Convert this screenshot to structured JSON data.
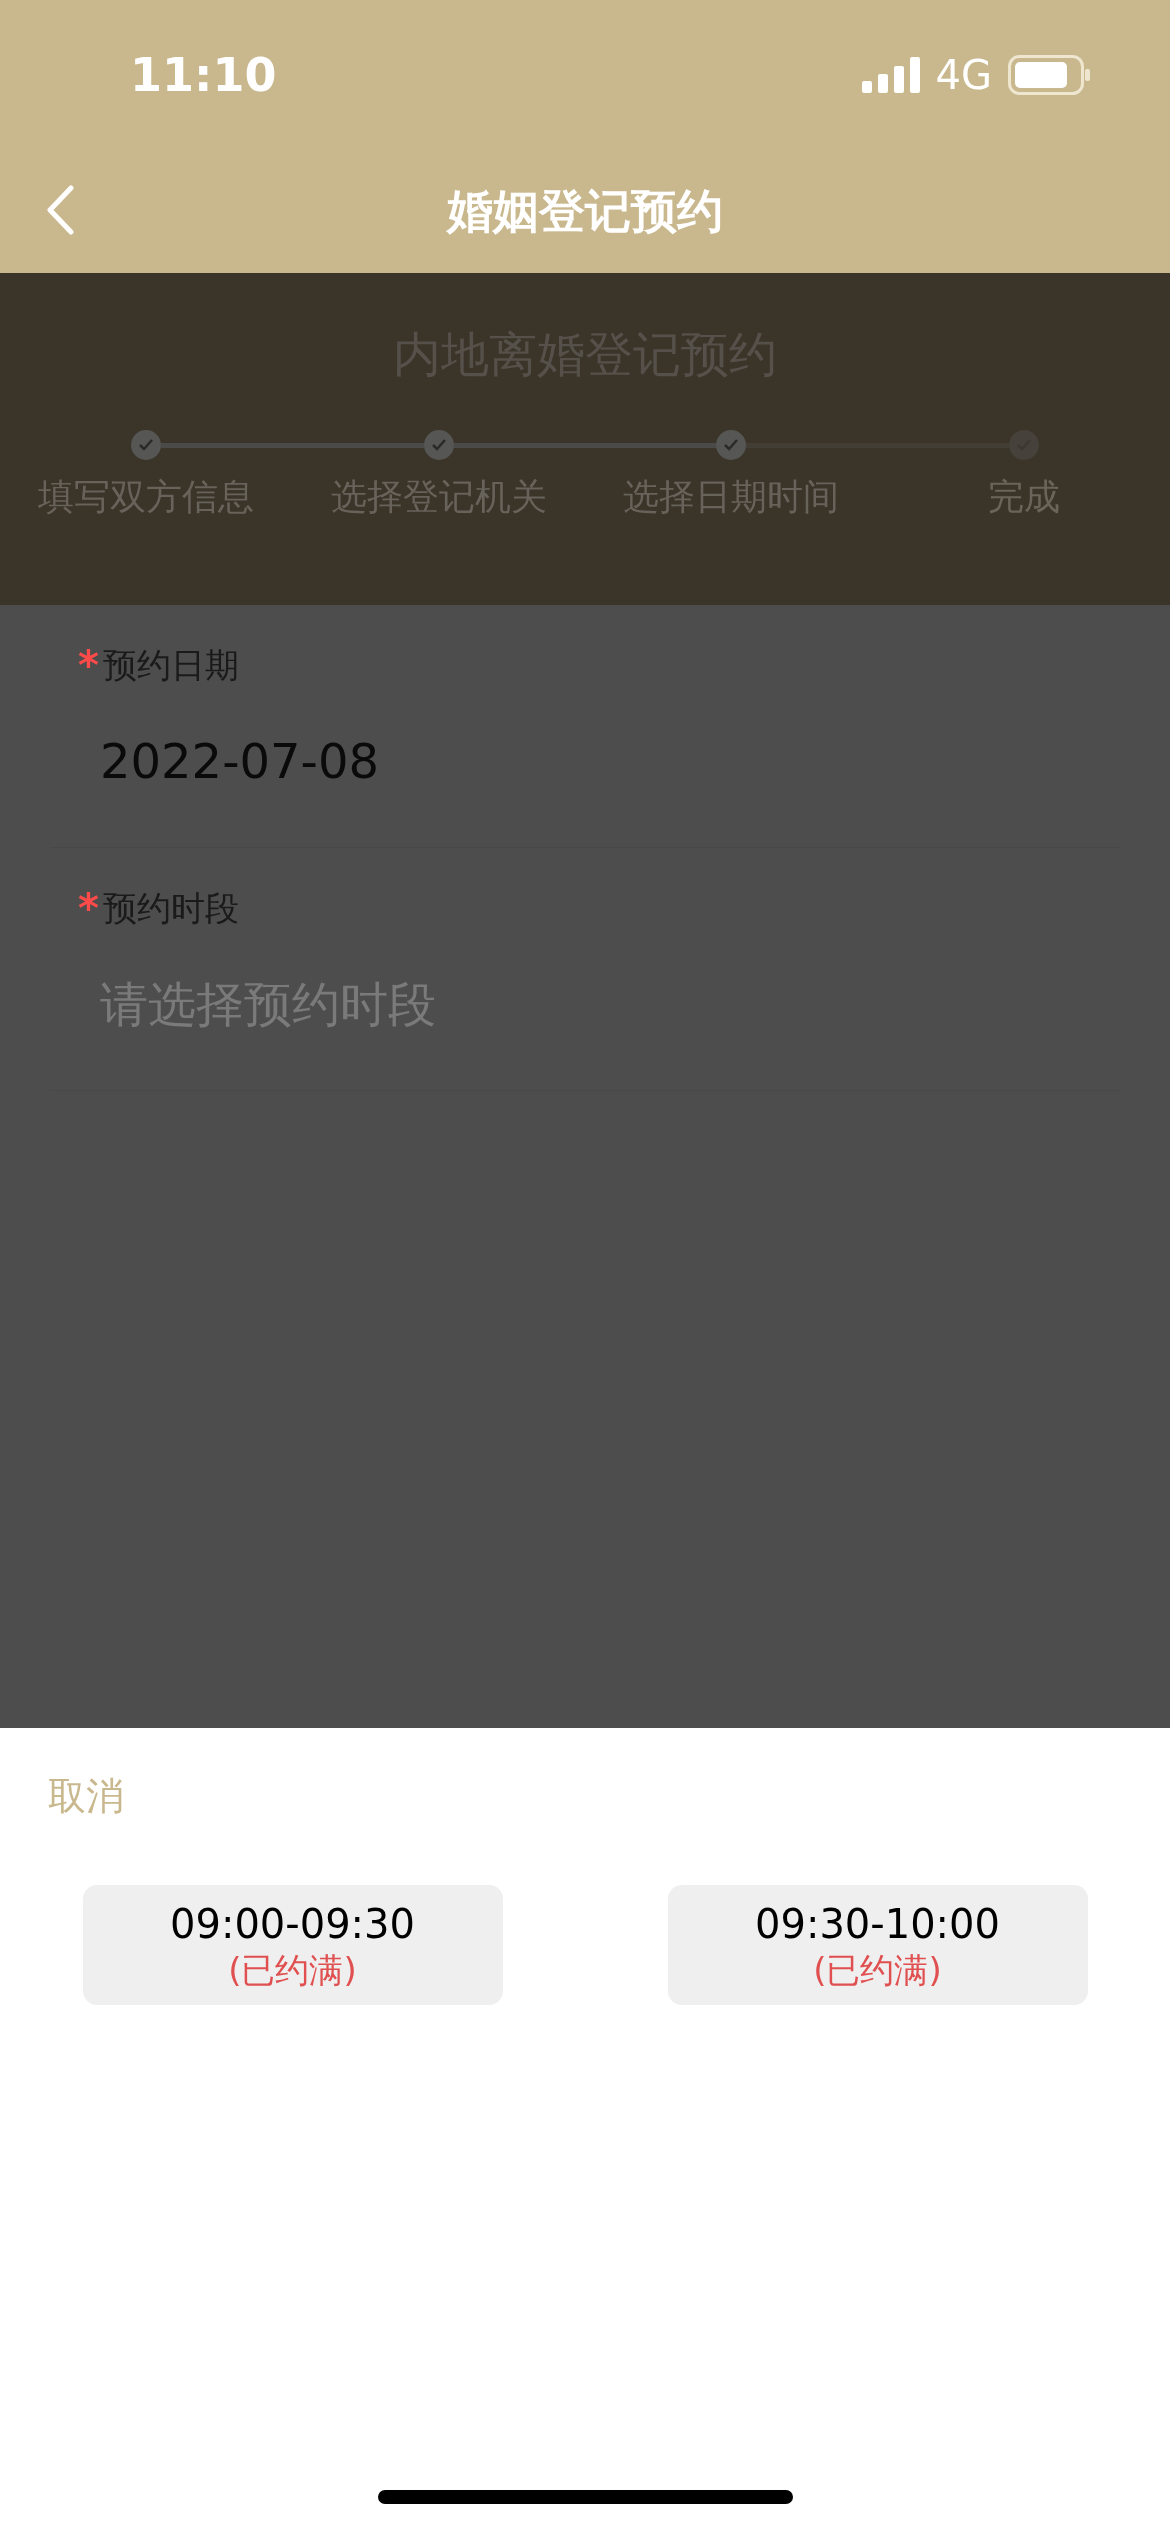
{
  "status_bar": {
    "time": "11:10",
    "network": "4G"
  },
  "nav": {
    "title": "婚姻登记预约"
  },
  "header": {
    "title": "内地离婚登记预约",
    "steps": [
      {
        "label": "填写双方信息",
        "done": true
      },
      {
        "label": "选择登记机关",
        "done": true
      },
      {
        "label": "选择日期时间",
        "done": true
      },
      {
        "label": "完成",
        "done": false
      }
    ]
  },
  "form": {
    "fields": [
      {
        "marker": "*",
        "label": "预约日期",
        "value": "2022-07-08"
      },
      {
        "marker": "*",
        "label": "预约时段",
        "placeholder": "请选择预约时段"
      }
    ]
  },
  "sheet": {
    "cancel": "取消",
    "slots": [
      {
        "time": "09:00-09:30",
        "status": "(已约满)"
      },
      {
        "time": "09:30-10:00",
        "status": "(已约满)"
      }
    ]
  }
}
